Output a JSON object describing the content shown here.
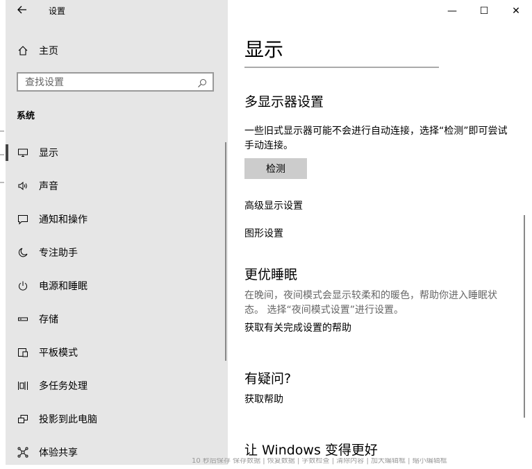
{
  "window": {
    "title": "设置",
    "back_icon": "back-arrow-icon",
    "controls": {
      "minimize": "—",
      "maximize": "☐",
      "close": "✕"
    }
  },
  "sidebar": {
    "home_label": "主页",
    "search_placeholder": "查找设置",
    "section_title": "系统",
    "items": [
      {
        "label": "显示",
        "icon": "monitor-icon",
        "active": true
      },
      {
        "label": "声音",
        "icon": "speaker-icon"
      },
      {
        "label": "通知和操作",
        "icon": "notification-icon"
      },
      {
        "label": "专注助手",
        "icon": "moon-icon"
      },
      {
        "label": "电源和睡眠",
        "icon": "power-icon"
      },
      {
        "label": "存储",
        "icon": "storage-icon"
      },
      {
        "label": "平板模式",
        "icon": "tablet-icon"
      },
      {
        "label": "多任务处理",
        "icon": "multitask-icon"
      },
      {
        "label": "投影到此电脑",
        "icon": "project-icon"
      },
      {
        "label": "体验共享",
        "icon": "share-icon"
      }
    ]
  },
  "main": {
    "title": "显示",
    "multi_display": {
      "heading": "多显示器设置",
      "description": "一些旧式显示器可能不会进行自动连接，选择“检测”即可尝试手动连接。",
      "detect_button": "检测",
      "advanced_link": "高级显示设置",
      "graphics_link": "图形设置"
    },
    "sleep": {
      "heading": "更优睡眠",
      "description": "在晚间，夜间模式会显示较柔和的暖色，帮助你进入睡眠状态。 选择“夜间模式设置”进行设置。",
      "help_link": "获取有关完成设置的帮助"
    },
    "questions": {
      "heading": "有疑问?",
      "help_link": "获取帮助"
    },
    "improve": {
      "heading": "让 Windows 变得更好"
    }
  },
  "footer_strip": "10 秒后保存 保存数据 | 恢复数据 | 字数检查 | 清除内容 | 加大编辑框 | 缩小编辑框"
}
